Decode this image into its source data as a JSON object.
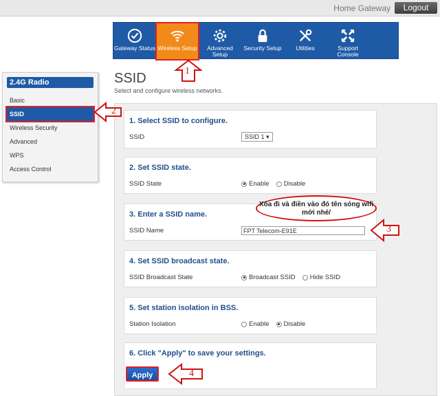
{
  "header": {
    "title": "Home Gateway",
    "logout_label": "Logout"
  },
  "nav": [
    {
      "label": "Gateway Status",
      "icon": "gauge-icon"
    },
    {
      "label": "Wireless Setup",
      "icon": "wifi-icon",
      "active": true
    },
    {
      "label": "Advanced Setup",
      "icon": "gear-icon"
    },
    {
      "label": "Security Setup",
      "icon": "lock-icon"
    },
    {
      "label": "Utilities",
      "icon": "tools-icon"
    },
    {
      "label": "Support Console",
      "icon": "move-icon"
    }
  ],
  "sidebar": {
    "heading": "2.4G Radio",
    "items": [
      "Basic",
      "SSID",
      "Wireless Security",
      "Advanced",
      "WPS",
      "Access Control"
    ],
    "active": "SSID"
  },
  "page": {
    "title": "SSID",
    "subtitle": "Select and configure wireless networks."
  },
  "sections": {
    "s1": {
      "title": "1. Select SSID to configure.",
      "label": "SSID",
      "value": "SSID 1"
    },
    "s2": {
      "title": "2. Set SSID state.",
      "label": "SSID State",
      "opt1": "Enable",
      "opt2": "Disable"
    },
    "s3": {
      "title": "3. Enter a SSID name.",
      "label": "SSID Name",
      "value": "FPT Telecom-E91E"
    },
    "s4": {
      "title": "4. Set SSID broadcast state.",
      "label": "SSID Broadcast State",
      "opt1": "Broadcast SSID",
      "opt2": "Hide SSID"
    },
    "s5": {
      "title": "5. Set station isolation in BSS.",
      "label": "Station Isolation",
      "opt1": "Enable",
      "opt2": "Disable"
    },
    "s6": {
      "title": "6. Click \"Apply\" to save your settings.",
      "apply_label": "Apply"
    }
  },
  "annotations": {
    "n1": "1",
    "n2": "2",
    "n3": "3",
    "n4": "4",
    "bubble_text": "Xóa đi và điền vào đó tên sóng wifi mới nhé/",
    "accent_color": "#d01010"
  }
}
